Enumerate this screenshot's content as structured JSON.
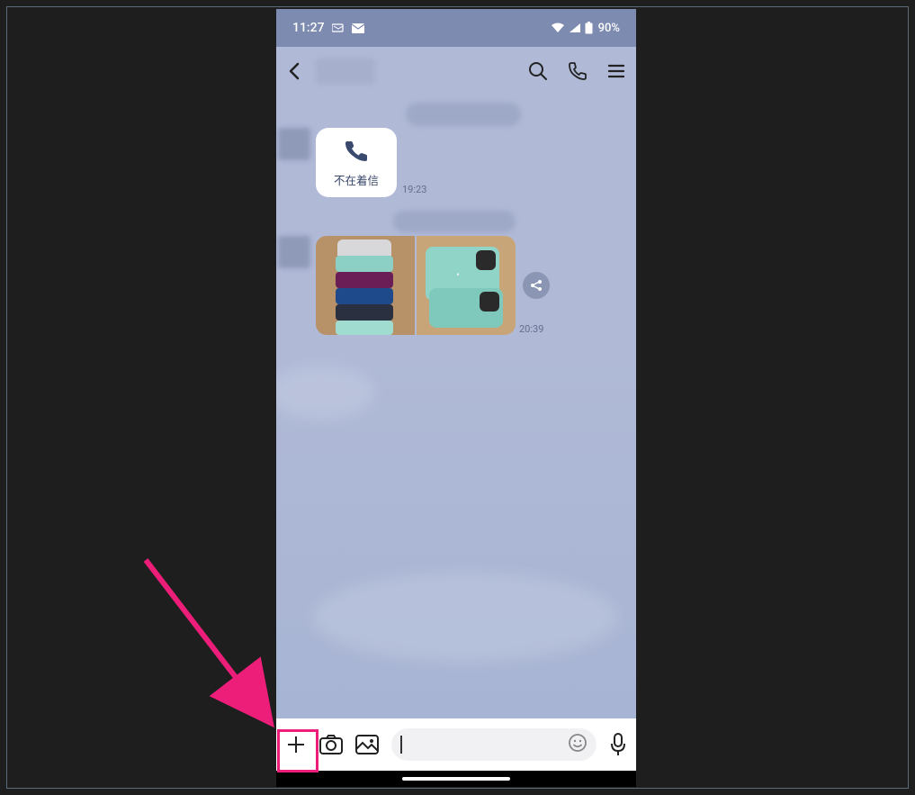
{
  "status": {
    "time": "11:27",
    "battery": "90%"
  },
  "header": {
    "title_blurred": true
  },
  "missed_call": {
    "label": "不在着信",
    "time": "19:23"
  },
  "photo_message": {
    "time": "20:39",
    "count": 2
  },
  "input": {
    "placeholder": ""
  }
}
